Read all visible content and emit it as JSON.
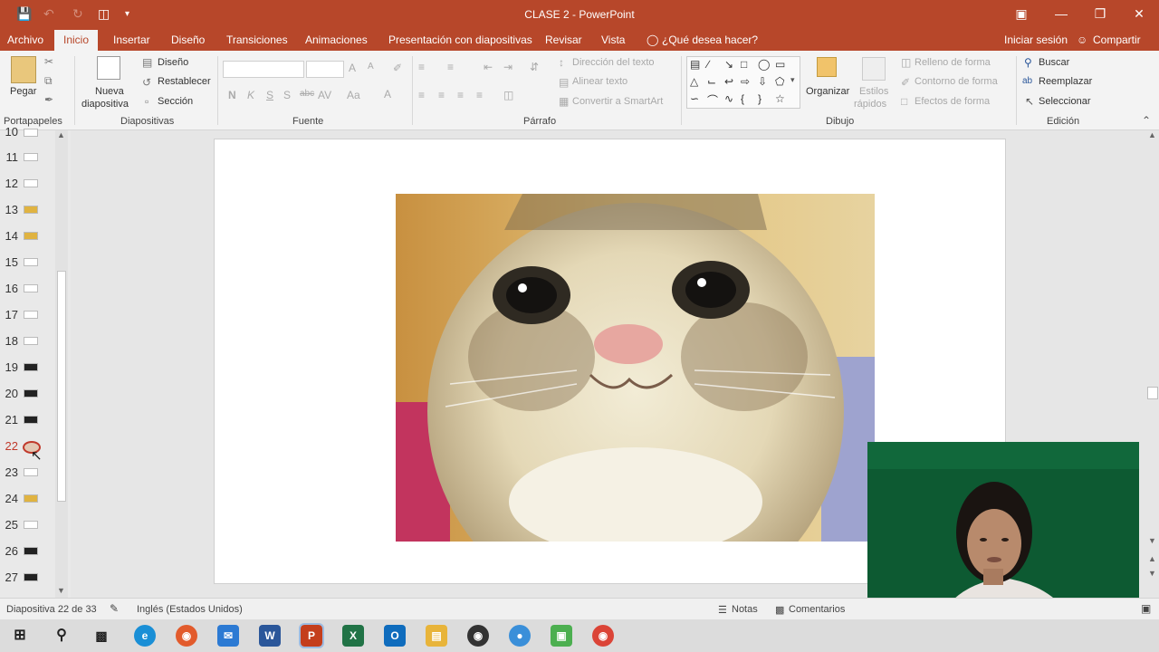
{
  "window": {
    "title": "CLASE 2 - PowerPoint",
    "qat": {
      "save_icon": "save-icon",
      "undo_icon": "undo-icon",
      "redo_icon": "redo-icon"
    }
  },
  "menu": {
    "archivo": "Archivo",
    "tabs": [
      "Inicio",
      "Insertar",
      "Diseño",
      "Transiciones",
      "Animaciones",
      "Presentación con diapositivas",
      "Revisar",
      "Vista"
    ],
    "tell_me": "¿Qué desea hacer?",
    "signin": "Iniciar sesión",
    "share": "Compartir"
  },
  "ribbon": {
    "clipboard": {
      "paste": "Pegar",
      "label": "Portapapeles"
    },
    "slides": {
      "new_slide": "Nueva",
      "new_slide2": "diapositiva",
      "layout": "Diseño",
      "reset": "Restablecer",
      "section": "Sección",
      "label": "Diapositivas"
    },
    "font": {
      "label": "Fuente",
      "bold": "N",
      "italic": "K",
      "underline": "S",
      "shadow": "S",
      "strike": "abc",
      "spacing": "AV",
      "case": "Aa",
      "grow": "A",
      "shrink": "A"
    },
    "paragraph": {
      "text_direction": "Dirección del texto",
      "align_text": "Alinear texto",
      "smartart": "Convertir a SmartArt",
      "label": "Párrafo"
    },
    "drawing": {
      "arrange": "Organizar",
      "quick_styles": "Estilos",
      "quick_styles2": "rápidos",
      "fill": "Relleno de forma",
      "outline": "Contorno de forma",
      "effects": "Efectos de forma",
      "label": "Dibujo"
    },
    "editing": {
      "find": "Buscar",
      "replace": "Reemplazar",
      "select": "Seleccionar",
      "label": "Edición"
    }
  },
  "thumbnails": {
    "numbers": [
      "10",
      "11",
      "12",
      "13",
      "14",
      "15",
      "16",
      "17",
      "18",
      "19",
      "20",
      "21",
      "22",
      "23",
      "24",
      "25",
      "26",
      "27"
    ],
    "active": "22"
  },
  "status": {
    "slide_info": "Diapositiva 22 de 33",
    "language": "Inglés (Estados Unidos)",
    "notes": "Notas",
    "comments": "Comentarios"
  },
  "taskbar": {
    "apps": [
      "start-icon",
      "search-icon",
      "task-view-icon",
      "edge-icon",
      "chrome-alt-icon",
      "mail-icon",
      "word-icon",
      "powerpoint-icon",
      "excel-icon",
      "outlook-icon",
      "file-explorer-icon",
      "obs-icon",
      "recorder-icon",
      "android-icon",
      "chrome-icon"
    ]
  },
  "colors": {
    "accent": "#b7472a",
    "active_slide": "#c0392b"
  }
}
